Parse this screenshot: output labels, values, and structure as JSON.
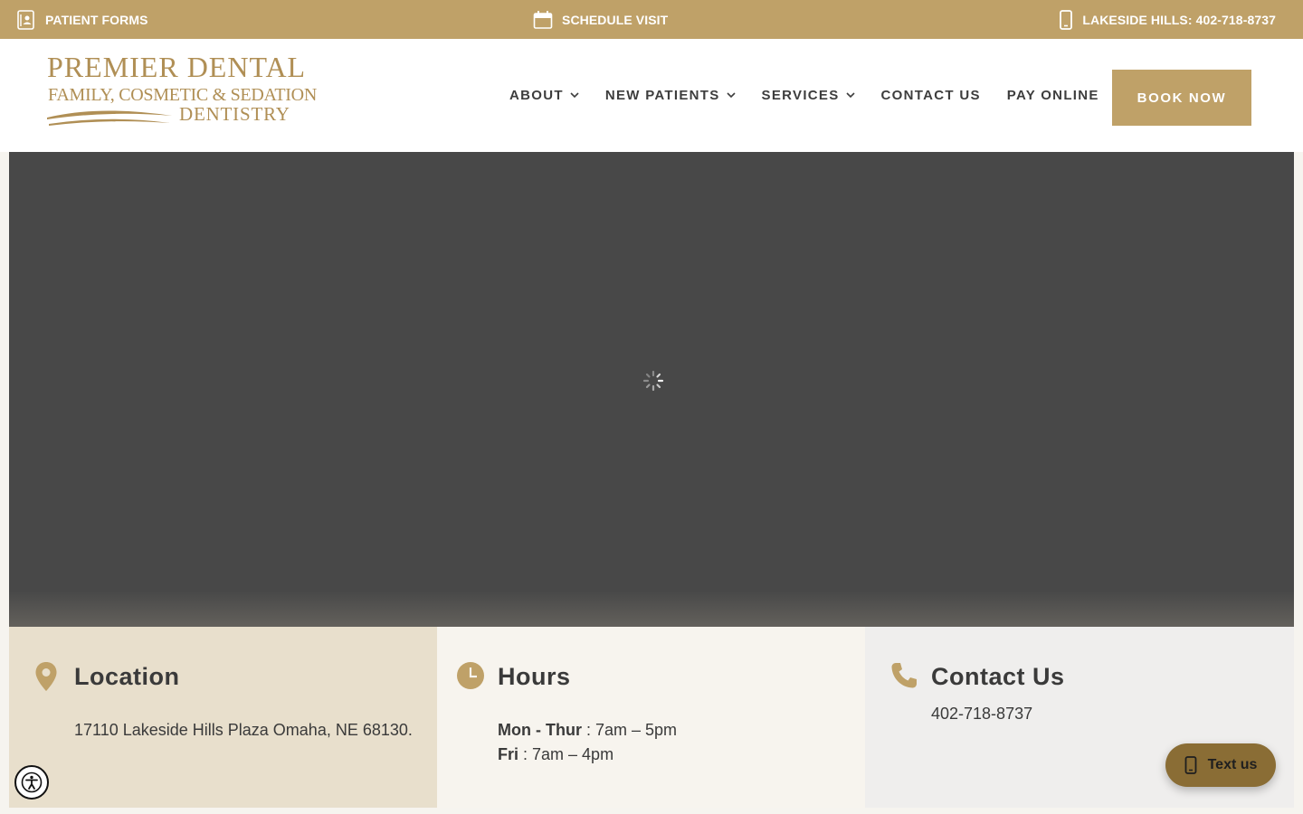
{
  "topbar": {
    "patient_forms": "PATIENT FORMS",
    "schedule_visit": "SCHEDULE VISIT",
    "phone": "LAKESIDE HILLS: 402-718-8737"
  },
  "logo": {
    "line1": "PREMIER DENTAL",
    "line2": "FAMILY, COSMETIC & SEDATION",
    "line3": "DENTISTRY"
  },
  "nav": {
    "items": [
      {
        "label": "ABOUT",
        "dropdown": true
      },
      {
        "label": "NEW PATIENTS",
        "dropdown": true
      },
      {
        "label": "SERVICES",
        "dropdown": true
      },
      {
        "label": "CONTACT US",
        "dropdown": false
      },
      {
        "label": "PAY ONLINE",
        "dropdown": false
      }
    ],
    "book_now": "BOOK NOW"
  },
  "info": {
    "location": {
      "title": "Location",
      "address": "17110 Lakeside Hills Plaza Omaha, NE 68130."
    },
    "hours": {
      "title": "Hours",
      "days1": "Mon - Thur",
      "time1": " : 7am – 5pm",
      "days2": "Fri",
      "time2": " : 7am – 4pm"
    },
    "contact": {
      "title": "Contact Us",
      "phone": "402-718-8737"
    }
  },
  "widgets": {
    "text_us": "Text us"
  },
  "colors": {
    "gold": "#bfa168",
    "dark_gold": "#8a6d35",
    "hero": "#484848"
  }
}
